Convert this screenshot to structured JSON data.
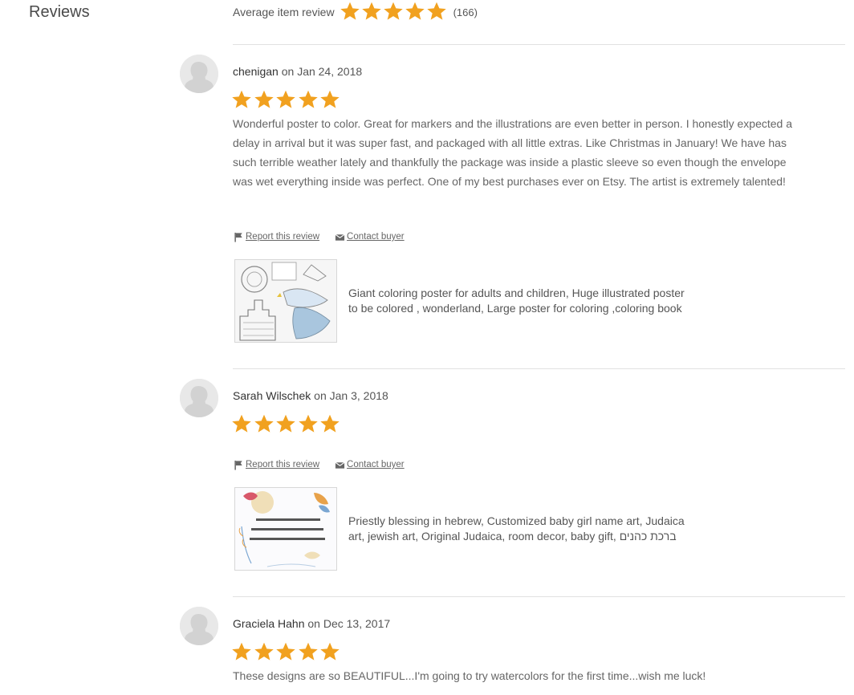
{
  "section": {
    "heading": "Reviews",
    "average_label": "Average item review",
    "average_rating": 5,
    "review_count": "(166)"
  },
  "reviews": [
    {
      "author": "chenigan",
      "date_prefix": "on",
      "date": "Jan 24, 2018",
      "rating": 5,
      "text": "Wonderful poster to color. Great for markers and the illustrations are even better in person. I honestly expected a delay in arrival but it was super fast, and packaged with all little extras. Like Christmas in January! We have has such terrible weather lately and thankfully the package was inside a plastic sleeve so even though the envelope was wet everything inside was perfect. One of my best purchases ever on Etsy. The artist is extremely talented!",
      "report_label": "Report this review",
      "contact_label": "Contact buyer",
      "listing_title": "Giant coloring poster for adults and children, Huge illustrated poster to be colored , wonderland, Large poster for coloring ,coloring book"
    },
    {
      "author": "Sarah Wilschek",
      "date_prefix": "on",
      "date": "Jan 3, 2018",
      "rating": 5,
      "text": "",
      "report_label": "Report this review",
      "contact_label": "Contact buyer",
      "listing_title": "Priestly blessing in hebrew, Customized baby girl name art, Judaica art, jewish art, Original Judaica, room decor, baby gift, ברכת כהנים"
    },
    {
      "author": "Graciela Hahn",
      "date_prefix": "on",
      "date": "Dec 13, 2017",
      "rating": 5,
      "text": "These designs are so BEAUTIFUL...I'm going to try watercolors for the first time...wish me luck!"
    }
  ],
  "colors": {
    "star": "#f1a11f",
    "text": "#666666",
    "divider": "#e1e1e1"
  },
  "icons": {
    "star": "star-icon",
    "flag": "flag-icon",
    "contact": "envelope-icon",
    "avatar": "default-avatar-icon"
  }
}
